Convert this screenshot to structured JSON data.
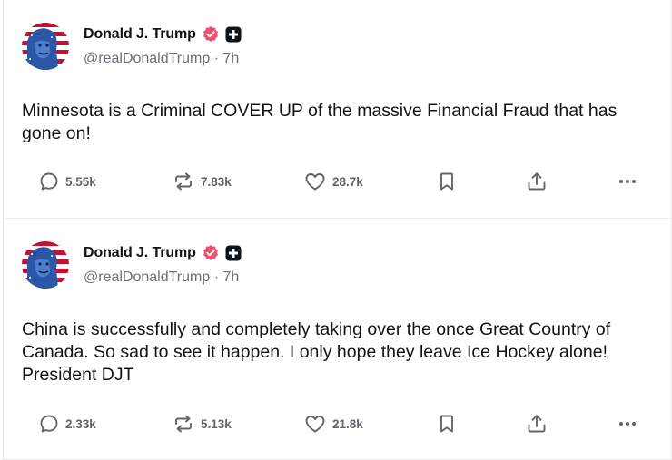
{
  "colors": {
    "verified_badge": "#f0506e",
    "icon_gray": "#60656c",
    "text": "#0f1419",
    "muted": "#6b6f76",
    "border": "#ececec"
  },
  "posts": [
    {
      "author_name": "Donald J. Trump",
      "handle": "@realDonaldTrump",
      "separator": "·",
      "time": "7h",
      "text": "Minnesota is a Criminal COVER UP of the massive Financial Fraud that has gone on!",
      "replies": "5.55k",
      "reposts": "7.83k",
      "likes": "28.7k",
      "icons": {
        "reply": "chat-bubble-icon",
        "repost": "repost-arrows-icon",
        "like": "heart-icon",
        "bookmark": "bookmark-icon",
        "share": "share-upload-icon",
        "more": "more-dots-icon"
      }
    },
    {
      "author_name": "Donald J. Trump",
      "handle": "@realDonaldTrump",
      "separator": "·",
      "time": "7h",
      "text": "China is successfully and completely taking over the once Great Country of Canada. So sad to see it happen. I only hope they leave Ice Hockey alone! President DJT",
      "replies": "2.33k",
      "reposts": "5.13k",
      "likes": "21.8k",
      "icons": {
        "reply": "chat-bubble-icon",
        "repost": "repost-arrows-icon",
        "like": "heart-icon",
        "bookmark": "bookmark-icon",
        "share": "share-upload-icon",
        "more": "more-dots-icon"
      }
    }
  ]
}
